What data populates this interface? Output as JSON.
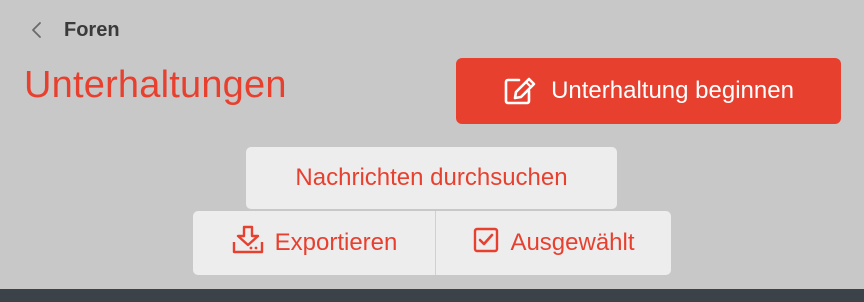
{
  "breadcrumb": {
    "label": "Foren"
  },
  "page": {
    "title": "Unterhaltungen"
  },
  "actions": {
    "start_conversation": "Unterhaltung beginnen",
    "search_messages": "Nachrichten durchsuchen",
    "export": "Exportieren",
    "selected": "Ausgewählt"
  },
  "colors": {
    "accent": "#e8402f",
    "background": "#c8c8c8",
    "button_bg": "#ededed",
    "bottom_bar": "#3b4248"
  },
  "icons": {
    "back": "chevron-left-icon",
    "start": "edit-icon",
    "export": "download-tray-icon",
    "selected": "checkbox-checked-icon"
  }
}
